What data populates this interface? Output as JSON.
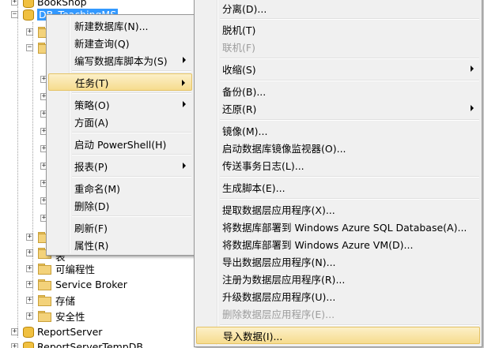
{
  "tree": {
    "items": [
      {
        "label": "BookShop"
      },
      {
        "label": "DB_TeachingMS"
      },
      {
        "label": "可编程性"
      },
      {
        "label": "Service Broker"
      },
      {
        "label": "存储"
      },
      {
        "label": "安全性"
      },
      {
        "label": "ReportServer"
      },
      {
        "label": "ReportServerTempDB"
      }
    ],
    "partial_label": "表"
  },
  "context_menu": {
    "items": [
      {
        "label": "新建数据库(N)..."
      },
      {
        "label": "新建查询(Q)"
      },
      {
        "label": "编写数据库脚本为(S)"
      },
      {
        "label": "任务(T)"
      },
      {
        "label": "策略(O)"
      },
      {
        "label": "方面(A)"
      },
      {
        "label": "启动 PowerShell(H)"
      },
      {
        "label": "报表(P)"
      },
      {
        "label": "重命名(M)"
      },
      {
        "label": "删除(D)"
      },
      {
        "label": "刷新(F)"
      },
      {
        "label": "属性(R)"
      }
    ]
  },
  "tasks_submenu": {
    "items": [
      {
        "label": "分离(D)..."
      },
      {
        "label": "脱机(T)"
      },
      {
        "label": "联机(F)"
      },
      {
        "label": "收缩(S)"
      },
      {
        "label": "备份(B)..."
      },
      {
        "label": "还原(R)"
      },
      {
        "label": "镜像(M)..."
      },
      {
        "label": "启动数据库镜像监视器(O)..."
      },
      {
        "label": "传送事务日志(L)..."
      },
      {
        "label": "生成脚本(E)..."
      },
      {
        "label": "提取数据层应用程序(X)..."
      },
      {
        "label": "将数据库部署到 Windows Azure SQL Database(A)..."
      },
      {
        "label": "将数据库部署到 Windows Azure VM(D)..."
      },
      {
        "label": "导出数据层应用程序(N)..."
      },
      {
        "label": "注册为数据层应用程序(R)..."
      },
      {
        "label": "升级数据层应用程序(U)..."
      },
      {
        "label": "删除数据层应用程序(E)..."
      },
      {
        "label": "导入数据(I)..."
      }
    ]
  }
}
